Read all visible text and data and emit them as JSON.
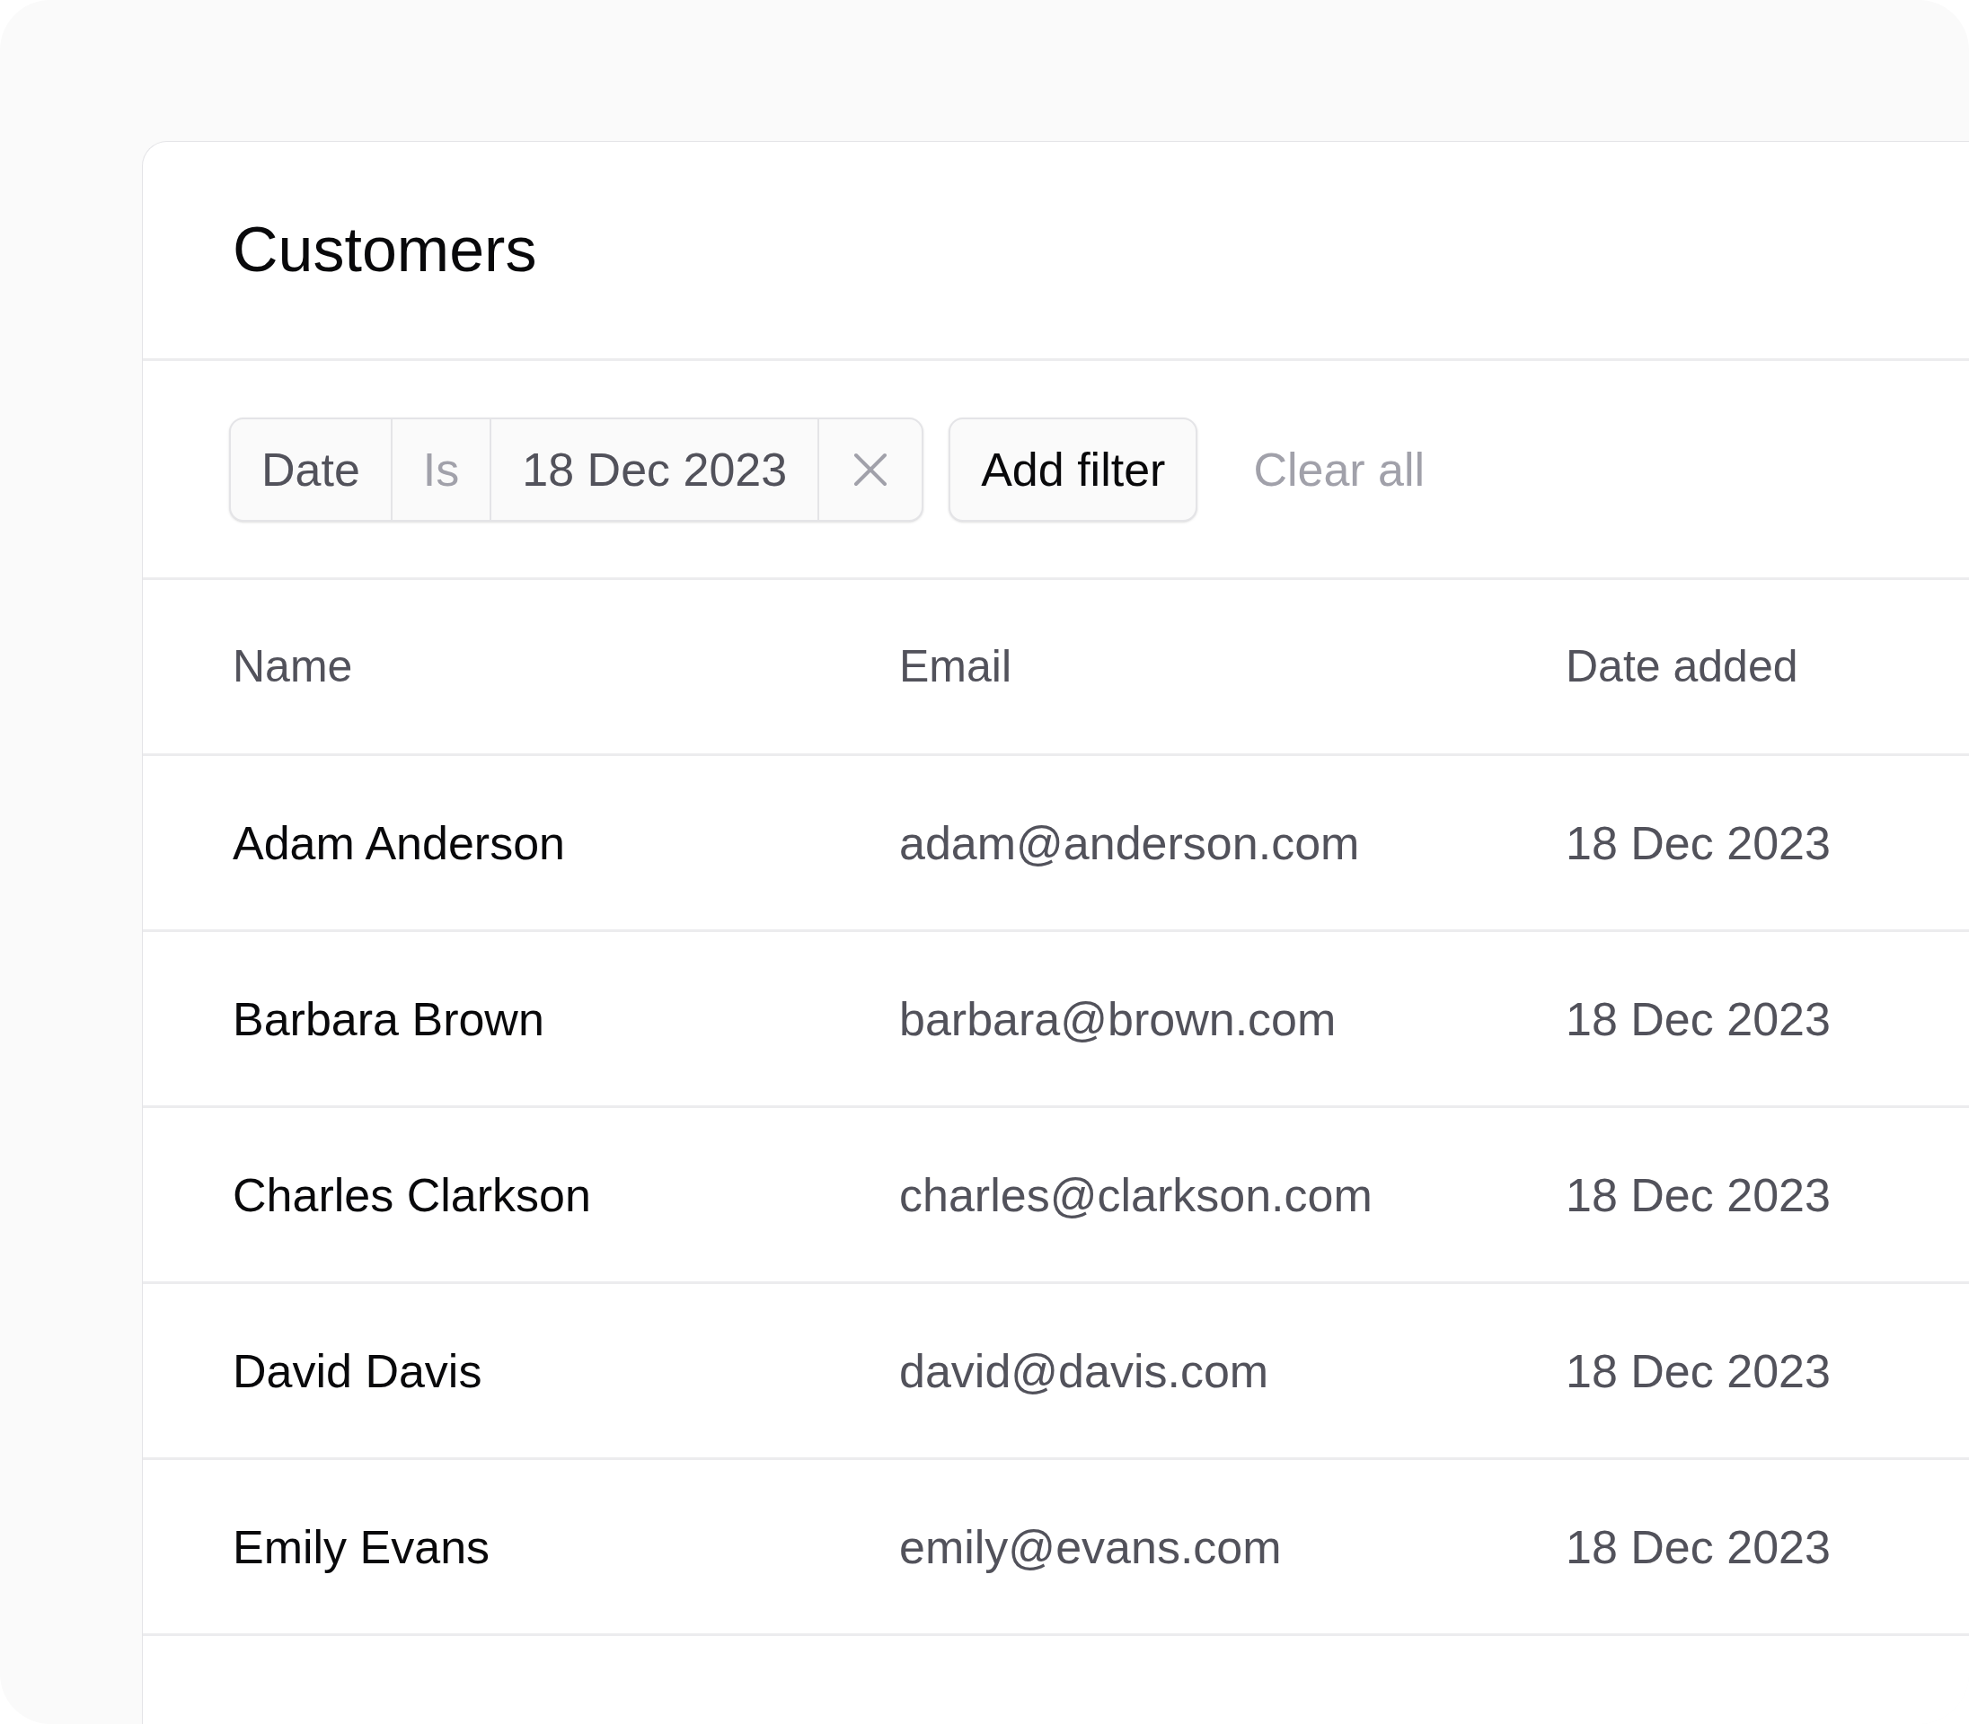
{
  "page": {
    "title": "Customers"
  },
  "filters": [
    {
      "field": "Date",
      "operator": "Is",
      "value": "18 Dec 2023"
    }
  ],
  "add_filter": "Add filter",
  "clear_all": "Clear all",
  "table": {
    "columns": [
      "Name",
      "Email",
      "Date added"
    ],
    "rows": [
      {
        "name": "Adam Anderson",
        "email": "adam@anderson.com",
        "date_added": "18 Dec 2023"
      },
      {
        "name": "Barbara Brown",
        "email": "barbara@brown.com",
        "date_added": "18 Dec 2023"
      },
      {
        "name": "Charles Clarkson",
        "email": "charles@clarkson.com",
        "date_added": "18 Dec 2023"
      },
      {
        "name": "David Davis",
        "email": "david@davis.com",
        "date_added": "18 Dec 2023"
      },
      {
        "name": "Emily Evans",
        "email": "emily@evans.com",
        "date_added": "18 Dec 2023"
      }
    ]
  }
}
